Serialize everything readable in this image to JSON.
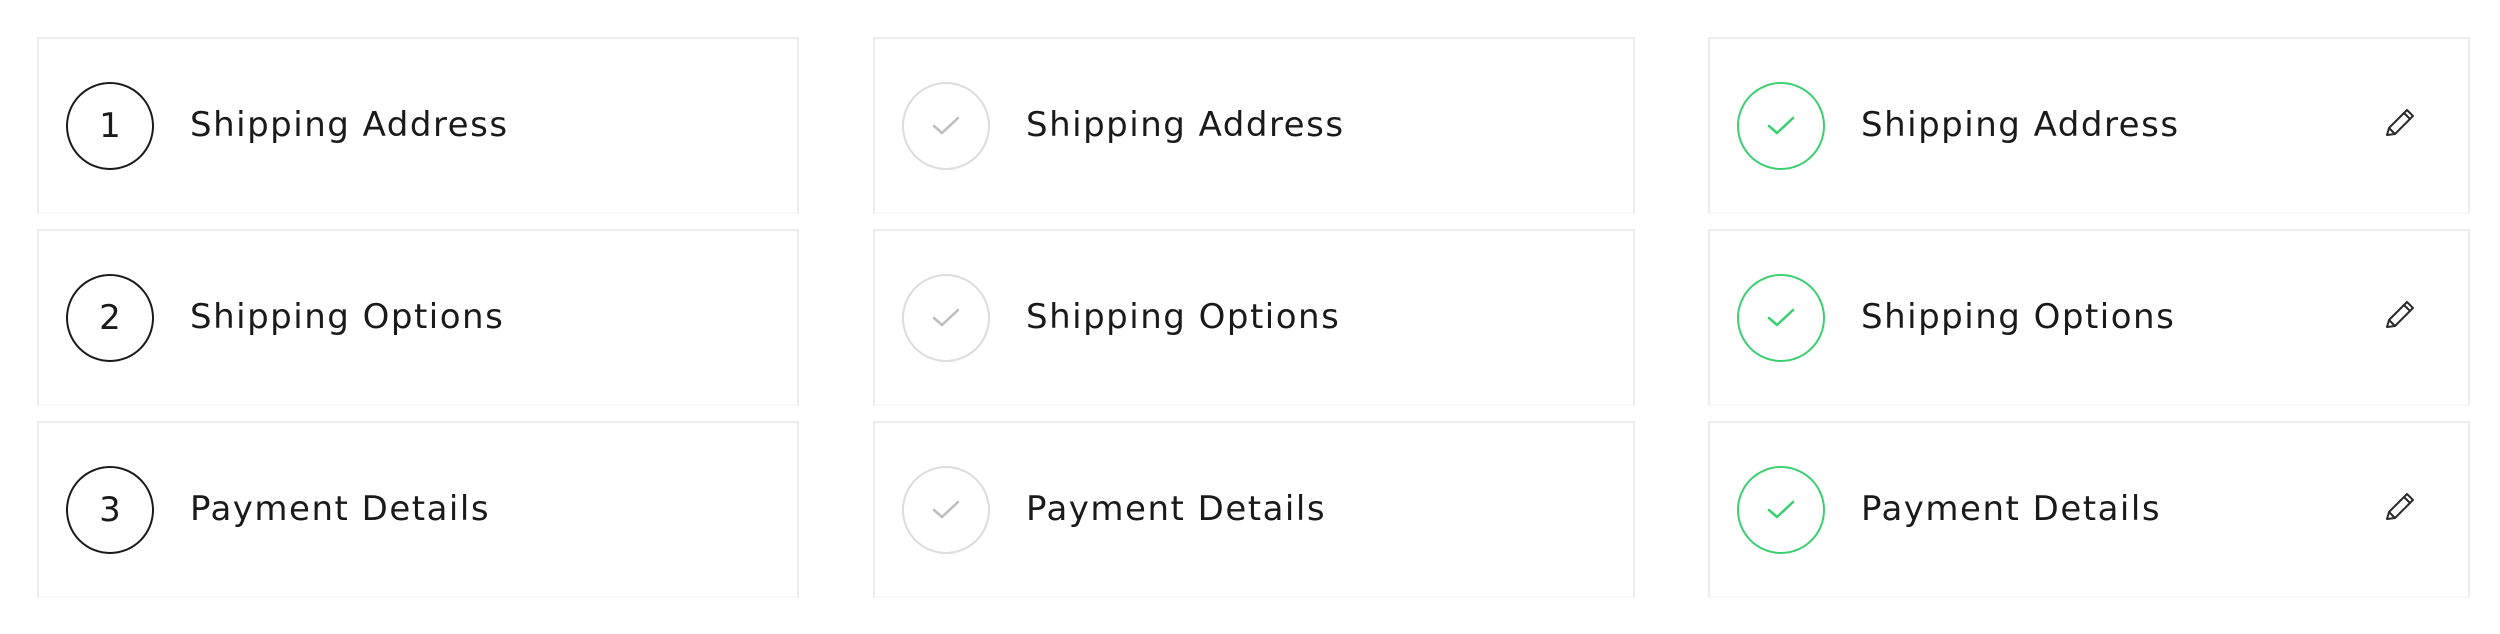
{
  "steps": [
    {
      "number": "1",
      "label": "Shipping Address"
    },
    {
      "number": "2",
      "label": "Shipping Options"
    },
    {
      "number": "3",
      "label": "Payment Details"
    }
  ],
  "states": {
    "pending": {
      "icon": "number-circle",
      "color": "#1a1a1a"
    },
    "inactive": {
      "icon": "check-icon",
      "color": "#c8c8c8"
    },
    "complete": {
      "icon": "check-icon",
      "color": "#3bcf72",
      "action_icon": "pencil-icon"
    }
  }
}
